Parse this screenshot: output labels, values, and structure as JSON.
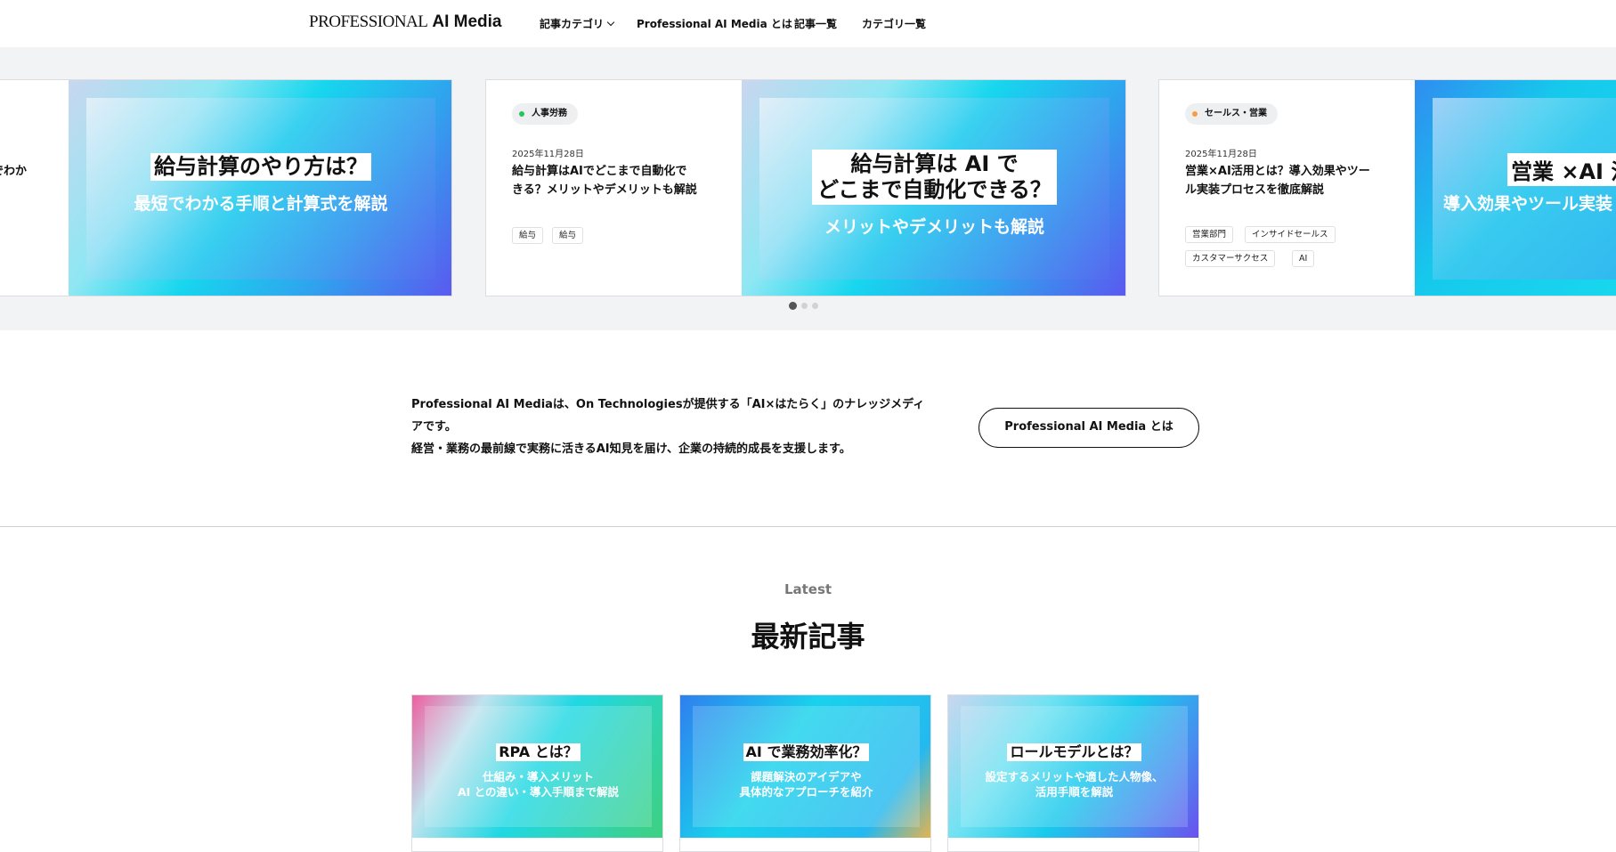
{
  "header": {
    "logo_part1": "PROFESSIONAL",
    "logo_part2": "AI Media",
    "nav": {
      "categories": "記事カテゴリ",
      "about": "Professional AI Media とは",
      "articles": "記事一覧",
      "category_list": "カテゴリ一覧"
    }
  },
  "carousel": {
    "left_card": {
      "title_fragment": "でわか",
      "thumb_title": "給与計算のやり方は？",
      "thumb_sub": "最短でわかる手順と計算式を解説"
    },
    "center_card": {
      "badge": "人事労務",
      "badge_color": "#22c55e",
      "date": "2025年11月28日",
      "title_line1": "給与計算はAIでどこまで自動化で",
      "title_line2": "きる？メリットやデメリットも解説",
      "tags": [
        "給与",
        "給与"
      ],
      "thumb_title_line1": "給与計算は AI で",
      "thumb_title_line2": "どこまで自動化できる？",
      "thumb_sub": "メリットやデメリットも解説"
    },
    "right_card": {
      "badge": "セールス・営業",
      "badge_color": "#f59e42",
      "date": "2025年11月28日",
      "title_line1": "営業×AI活用とは？導入効果やツー",
      "title_line2": "ル実装プロセスを徹底解説",
      "tags": [
        "営業部門",
        "インサイドセールス",
        "カスタマーサクセス",
        "AI"
      ],
      "thumb_title": "営業 ×AI 活",
      "thumb_sub": "導入効果やツール実装"
    },
    "pagination": {
      "total": 3,
      "active": 1
    }
  },
  "about": {
    "line1": "Professional AI Mediaは、On Technologiesが提供する「AI×はたらく」のナレッジメディ",
    "line2": "アです。",
    "line3": "経営・業務の最前線で実務に活きるAI知見を届け、企業の持続的成長を支援します。",
    "button": "Professional AI Media とは"
  },
  "latest": {
    "label": "Latest",
    "title": "最新記事",
    "cards": [
      {
        "title": "RPA とは？",
        "sub1": "仕組み・導入メリット",
        "sub2": "AI との違い・導入手順まで解説"
      },
      {
        "title": "AI で業務効率化？",
        "sub1": "課題解決のアイデアや",
        "sub2": "具体的なアプローチを紹介"
      },
      {
        "title": "ロールモデルとは？",
        "sub1": "設定するメリットや適した人物像、",
        "sub2": "活用手順を解説"
      }
    ]
  }
}
